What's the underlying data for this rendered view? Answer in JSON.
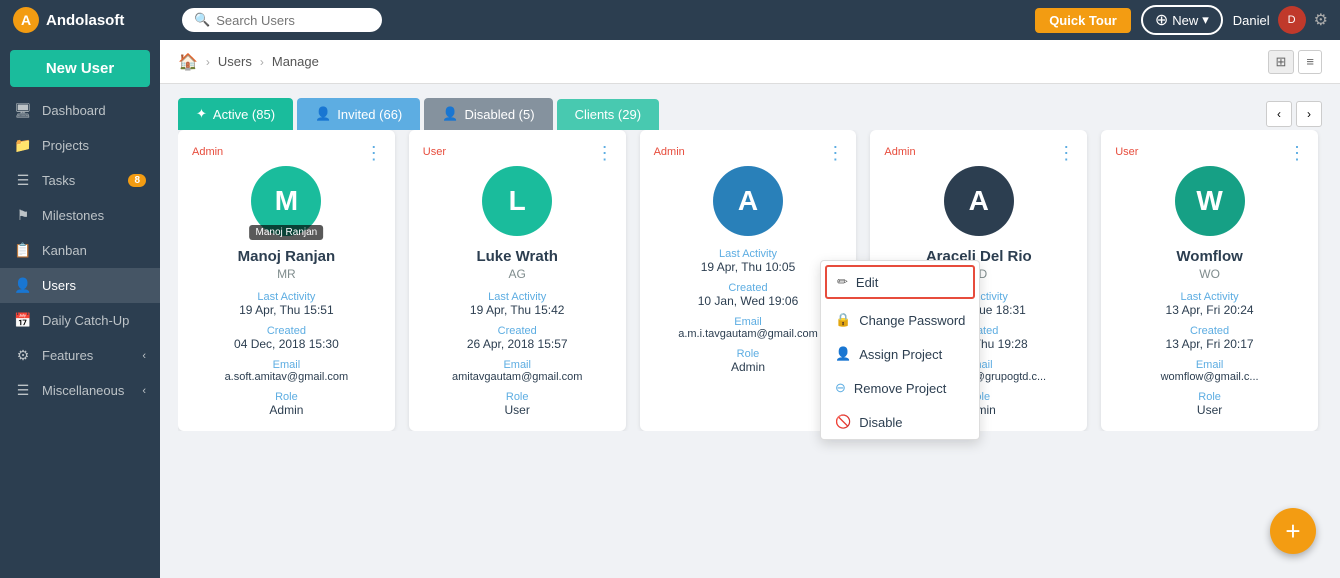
{
  "app": {
    "logo_text": "Andolasoft",
    "logo_icon": "🔥"
  },
  "topnav": {
    "search_placeholder": "Search Users",
    "quick_tour_label": "Quick Tour",
    "new_label": "New",
    "user_name": "Daniel",
    "gear_icon": "⚙"
  },
  "sidebar": {
    "new_user_label": "New User",
    "items": [
      {
        "id": "dashboard",
        "label": "Dashboard",
        "icon": "🖥",
        "badge": null
      },
      {
        "id": "projects",
        "label": "Projects",
        "icon": "📁",
        "badge": null
      },
      {
        "id": "tasks",
        "label": "Tasks",
        "icon": "☰",
        "badge": "8"
      },
      {
        "id": "milestones",
        "label": "Milestones",
        "icon": "🏁",
        "badge": null
      },
      {
        "id": "kanban",
        "label": "Kanban",
        "icon": "📋",
        "badge": null
      },
      {
        "id": "users",
        "label": "Users",
        "icon": "👤",
        "badge": null,
        "active": true
      },
      {
        "id": "daily-catchup",
        "label": "Daily Catch-Up",
        "icon": "📅",
        "badge": null
      },
      {
        "id": "features",
        "label": "Features",
        "icon": "⚙",
        "badge": null,
        "arrow": "‹"
      },
      {
        "id": "miscellaneous",
        "label": "Miscellaneous",
        "icon": "☰",
        "badge": null,
        "arrow": "‹"
      }
    ]
  },
  "breadcrumb": {
    "home_icon": "🏠",
    "items": [
      "Users",
      "Manage"
    ]
  },
  "view_toggle": {
    "grid_icon": "⊞",
    "list_icon": "≡"
  },
  "tabs": [
    {
      "id": "active",
      "label": "Active (85)",
      "icon": "✦",
      "class": "active-tab"
    },
    {
      "id": "invited",
      "label": "Invited (66)",
      "icon": "👤",
      "class": "invited-tab"
    },
    {
      "id": "disabled",
      "label": "Disabled (5)",
      "icon": "👤",
      "class": "disabled-tab"
    },
    {
      "id": "clients",
      "label": "Clients (29)",
      "icon": "",
      "class": "clients-tab"
    }
  ],
  "pagination": {
    "prev": "‹",
    "next": "›"
  },
  "cards": [
    {
      "id": "manoj",
      "role": "Admin",
      "avatar_color": "#1abc9c",
      "avatar_letter": "M",
      "name": "Manoj Ranjan",
      "initials": "MR",
      "show_tooltip": true,
      "tooltip": "Manoj Ranjan",
      "last_activity_label": "Last Activity",
      "last_activity": "19 Apr, Thu 15:51",
      "created_label": "Created",
      "created": "04 Dec, 2018 15:30",
      "email_label": "Email",
      "email": "a.soft.amitav@gmail.com",
      "role_label": "Role",
      "role_value": "Admin"
    },
    {
      "id": "luke",
      "role": "User",
      "avatar_color": "#1abc9c",
      "avatar_letter": "L",
      "name": "Luke Wrath",
      "initials": "AG",
      "show_tooltip": false,
      "last_activity_label": "Last Activity",
      "last_activity": "19 Apr, Thu 15:42",
      "created_label": "Created",
      "created": "26 Apr, 2018 15:57",
      "email_label": "Email",
      "email": "amitavgautam@gmail.com",
      "role_label": "Role",
      "role_value": "User"
    },
    {
      "id": "third",
      "role": "Admin",
      "avatar_color": "#2980b9",
      "avatar_letter": "A",
      "name": "",
      "initials": "",
      "show_tooltip": false,
      "last_activity_label": "Last Activity",
      "last_activity": "19 Apr, Thu 10:05",
      "created_label": "Created",
      "created": "10 Jan, Wed 19:06",
      "email_label": "Email",
      "email": "a.m.i.tavgautam@gmail.com",
      "role_label": "Role",
      "role_value": "Admin"
    },
    {
      "id": "araceli",
      "role": "Admin",
      "avatar_color": "#2c3e50",
      "avatar_letter": "A",
      "name": "Araceli Del Rio",
      "initials": "AD",
      "show_tooltip": false,
      "last_activity_label": "Last Activity",
      "last_activity": "17 Apr, Tue 18:31",
      "created_label": "Created",
      "created": "22 Feb, Thu 19:28",
      "email_label": "Email",
      "email": "araceli.delrio@grupogtd.c...",
      "role_label": "Role",
      "role_value": "Admin"
    },
    {
      "id": "womflow",
      "role": "User",
      "avatar_color": "#16a085",
      "avatar_letter": "W",
      "name": "Womflow",
      "initials": "WO",
      "show_tooltip": false,
      "last_activity_label": "Last Activity",
      "last_activity": "13 Apr, Fri 20:24",
      "created_label": "Created",
      "created": "13 Apr, Fri 20:17",
      "email_label": "Email",
      "email": "womflow@gmail.c...",
      "role_label": "Role",
      "role_value": "User"
    }
  ],
  "dropdown": {
    "edit": "Edit",
    "change_password": "Change Password",
    "assign_project": "Assign Project",
    "remove_project": "Remove Project",
    "disable": "Disable"
  },
  "fab": "+"
}
